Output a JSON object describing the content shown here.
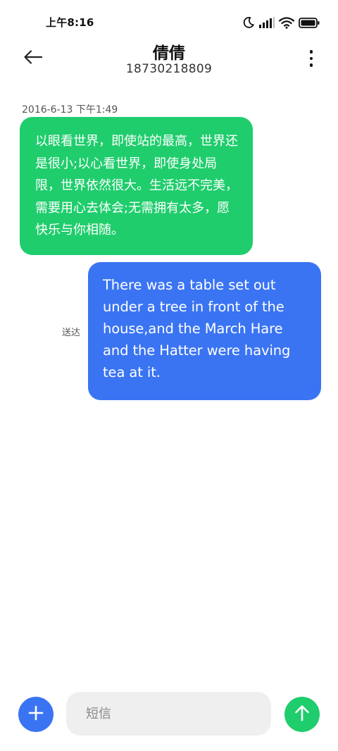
{
  "status_bar": {
    "time": "上午8:16",
    "icons": [
      "moon-icon",
      "signal-icon",
      "wifi-icon",
      "battery-icon"
    ]
  },
  "header": {
    "contact_name": "倩倩",
    "contact_number": "18730218809",
    "back_icon": "arrow-left-icon",
    "more_icon": "more-vertical-icon"
  },
  "messages": [
    {
      "direction": "incoming",
      "timestamp": "2016-6-13 下午1:49",
      "text": "以眼看世界，即使站的最高，世界还是很小;以心看世界，即使身处局限，世界依然很大。生活远不完美，需要用心去体会;无需拥有太多，愿快乐与你相随。"
    },
    {
      "direction": "outgoing",
      "status": "送达",
      "text": "There was a table set out under a tree in front of the house,and the March Hare and the Hatter were having tea at it."
    }
  ],
  "composer": {
    "placeholder": "短信",
    "add_icon": "plus-icon",
    "send_icon": "arrow-up-icon"
  },
  "colors": {
    "incoming_bubble": "#1fcd6c",
    "outgoing_bubble": "#3a74f3",
    "add_button": "#3a74f3",
    "send_button": "#1fcd6c",
    "input_background": "#efefef"
  }
}
